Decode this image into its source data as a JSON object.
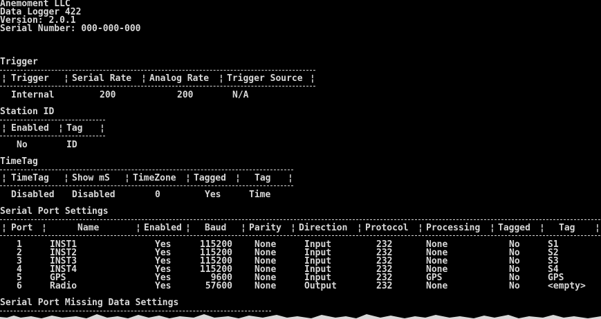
{
  "header": {
    "company": "Anemoment LLC",
    "product": "Data Logger 422",
    "version": "Version: 2.0.1",
    "serial": "Serial Number: 000-000-000"
  },
  "trigger": {
    "title": "Trigger",
    "columns": [
      "Trigger",
      "Serial Rate",
      "Analog Rate",
      "Trigger Source"
    ],
    "row": [
      "Internal",
      "200",
      "200",
      "N/A"
    ]
  },
  "station_id": {
    "title": "Station ID",
    "columns": [
      "Enabled",
      "Tag"
    ],
    "row": [
      "No",
      "ID"
    ]
  },
  "timetag": {
    "title": "TimeTag",
    "columns": [
      "TimeTag",
      "Show mS",
      "TimeZone",
      "Tagged",
      "Tag"
    ],
    "row": [
      "Disabled",
      "Disabled",
      "0",
      "Yes",
      "Time"
    ]
  },
  "serial_ports": {
    "title": "Serial Port Settings",
    "columns": [
      "Port",
      "Name",
      "Enabled",
      "Baud",
      "Parity",
      "Direction",
      "Protocol",
      "Processing",
      "Tagged",
      "Tag"
    ],
    "rows": [
      [
        "1",
        "INST1",
        "Yes",
        "115200",
        "None",
        "Input",
        "232",
        "None",
        "No",
        "S1"
      ],
      [
        "2",
        "INST2",
        "Yes",
        "115200",
        "None",
        "Input",
        "232",
        "None",
        "No",
        "S2"
      ],
      [
        "3",
        "INST3",
        "Yes",
        "115200",
        "None",
        "Input",
        "232",
        "None",
        "No",
        "S3"
      ],
      [
        "4",
        "INST4",
        "Yes",
        "115200",
        "None",
        "Input",
        "232",
        "None",
        "No",
        "S4"
      ],
      [
        "5",
        "GPS",
        "Yes",
        "9600",
        "None",
        "Input",
        "232",
        "GPS",
        "No",
        "GPS"
      ],
      [
        "6",
        "Radio",
        "Yes",
        "57600",
        "None",
        "Output",
        "232",
        "None",
        "No",
        "<empty>"
      ]
    ]
  },
  "missing_data": {
    "title": "Serial Port Missing Data Settings"
  }
}
